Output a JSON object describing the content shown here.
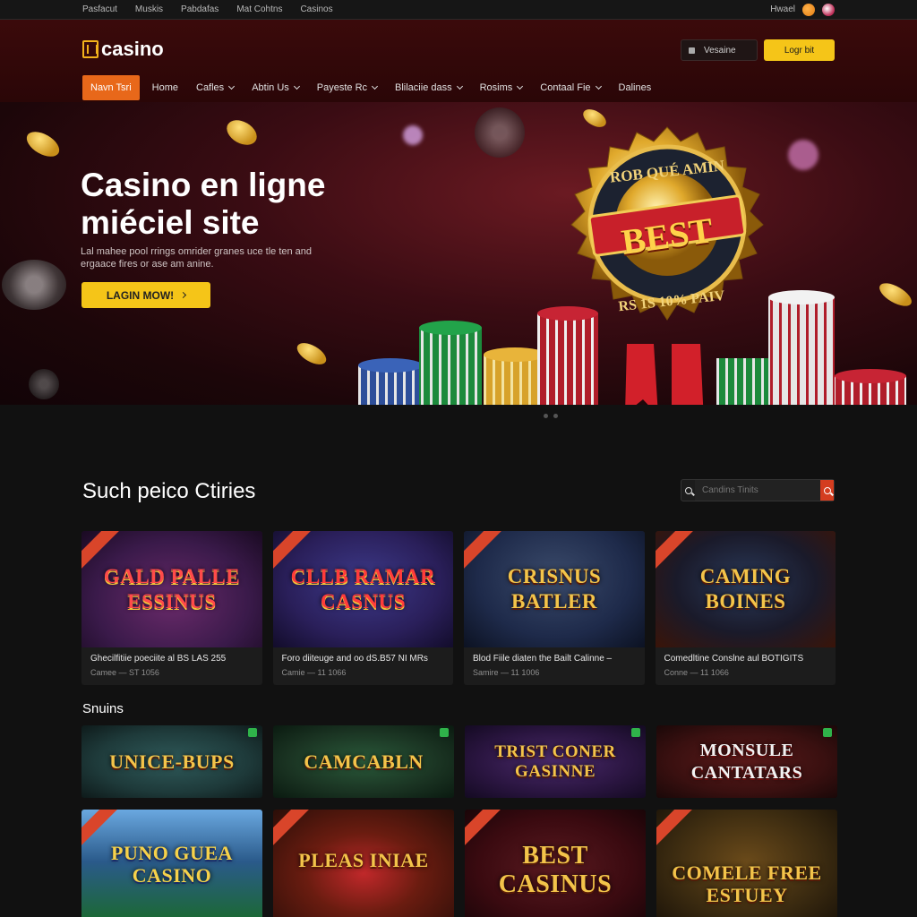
{
  "topbar": {
    "links": [
      "Pasfacut",
      "Muskis",
      "Pabdafas",
      "Mat Cohtns",
      "Casinos"
    ],
    "right_label": "Hwael"
  },
  "header": {
    "brand": "casino",
    "account_label": "Vesaine",
    "login_label": "Logr bit",
    "nav": [
      {
        "label": "Navn Tsri",
        "active": true,
        "dropdown": false
      },
      {
        "label": "Home",
        "active": false,
        "dropdown": false
      },
      {
        "label": "Cafles",
        "active": false,
        "dropdown": true
      },
      {
        "label": "Abtin Us",
        "active": false,
        "dropdown": true
      },
      {
        "label": "Payeste Rc",
        "active": false,
        "dropdown": true
      },
      {
        "label": "Blilaciie dass",
        "active": false,
        "dropdown": true
      },
      {
        "label": "Rosims",
        "active": false,
        "dropdown": true
      },
      {
        "label": "Contaal Fie",
        "active": false,
        "dropdown": true
      },
      {
        "label": "Dalines",
        "active": false,
        "dropdown": false
      }
    ]
  },
  "hero": {
    "title": "Casino en ligne miéciel site",
    "subtitle": "Lal mahee pool rrings omrider granes uce tle ten and ergaace fires or ase am anine.",
    "cta_label": "LAGIN MOW!",
    "badge_top": "ROB QUÉ AMIN",
    "badge_main": "BEST",
    "badge_bottom": "RS 1S 10% PAIV"
  },
  "featured": {
    "title": "Such peico Ctiries",
    "search_placeholder": "Candins Tinits",
    "cards": [
      {
        "art": "GALD PALLE ESSINUS",
        "name": "Ghecilfitiie poeciite al BS LAS 255",
        "meta": "Camee — ST 1056",
        "bg": "#3a1a4a"
      },
      {
        "art": "CLLB RAMAR CASNUS",
        "name": "Foro diiteuge and oo dS.B57 NI MRs",
        "meta": "Camie — 11 1066",
        "bg": "#2a1f5a"
      },
      {
        "art": "CRISNUS BATLER",
        "name": "Blod Fiile diaten the Bailt Calinne –",
        "meta": "Samire — 11 1006",
        "bg": "#1e2a4a"
      },
      {
        "art": "CAMING BOINES",
        "name": "Comedltine Conslne aul BOTIGITS",
        "meta": "Conne — 11 1066",
        "bg": "#3a1408"
      }
    ]
  },
  "section2": {
    "title": "Snuins",
    "tiles": [
      {
        "art": "UNICE-BUPS",
        "bg": "#1e3a3a",
        "badge": true,
        "ribbon": false,
        "tall": false
      },
      {
        "art": "CAMCABLN",
        "bg": "#1a3322",
        "badge": true,
        "ribbon": false,
        "tall": false
      },
      {
        "art": "TRIST CONER GASINNE",
        "bg": "#2a1540",
        "badge": true,
        "ribbon": false,
        "tall": false
      },
      {
        "art": "MONSULE CANTATARS",
        "bg": "#3a1010",
        "badge": true,
        "ribbon": false,
        "tall": false
      },
      {
        "art": "PUNO GUEA CASINO",
        "bg": "#2a5a8a",
        "badge": false,
        "ribbon": true,
        "tall": true
      },
      {
        "art": "PLEAS INIAE",
        "bg": "#4a1c10",
        "badge": false,
        "ribbon": true,
        "tall": true
      },
      {
        "art": "BEST CASINUS",
        "bg": "#3a0a10",
        "badge": false,
        "ribbon": true,
        "tall": true
      },
      {
        "art": "COMELE FREE ESTUEY",
        "bg": "#3a2a10",
        "badge": false,
        "ribbon": true,
        "tall": true
      }
    ]
  },
  "colors": {
    "header_bg": "#3b0a0b",
    "accent_orange": "#e8681a",
    "accent_yellow": "#f5c518",
    "search_red": "#d43d1f",
    "page_bg": "#111111"
  }
}
